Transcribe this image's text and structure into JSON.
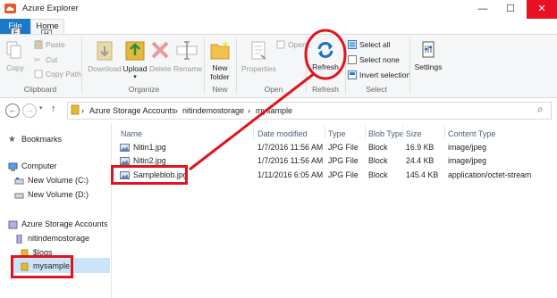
{
  "window": {
    "title": "Azure Explorer",
    "minimize": "—",
    "maximize": "☐",
    "close": "✕"
  },
  "ribbon_tabs": {
    "file": "File",
    "file_keytip": "F",
    "home": "Home",
    "home_keytip": "H"
  },
  "clipboard": {
    "copy": "Copy",
    "paste": "Paste",
    "cut": "Cut",
    "copy_path": "Copy Path",
    "label": "Clipboard"
  },
  "organize": {
    "download": "Download",
    "upload": "Upload",
    "delete": "Delete",
    "rename": "Rename",
    "label": "Organize"
  },
  "new_group": {
    "new_folder_line1": "New",
    "new_folder_line2": "folder",
    "label": "New"
  },
  "open_group": {
    "properties": "Properties",
    "open": "Open",
    "refresh": "Refresh",
    "label": "Open",
    "refresh_label": "Refresh"
  },
  "select_group": {
    "select_all": "Select all",
    "select_none": "Select none",
    "invert": "Invert selection",
    "label": "Select"
  },
  "settings": {
    "label": "Settings"
  },
  "address": {
    "root": "Azure Storage Accounts",
    "account": "nitindemostorage",
    "container": "mysample",
    "sep": "›",
    "back": "←",
    "forward": "→",
    "up": "↑",
    "search": "⌕"
  },
  "nav": {
    "bookmarks": "Bookmarks",
    "computer": "Computer",
    "drive_c": "New Volume (C:)",
    "drive_d": "New Volume (D:)",
    "azure": "Azure Storage Accounts",
    "account": "nitindemostorage",
    "logs": "$logs",
    "mysample": "mysample"
  },
  "columns": {
    "name": "Name",
    "date": "Date modified",
    "type": "Type",
    "blob_type": "Blob Type",
    "size": "Size",
    "content_type": "Content Type"
  },
  "files": [
    {
      "name": "Nitin1.jpg",
      "date": "1/7/2016 11:56 AM",
      "type": "JPG File",
      "blob_type": "Block",
      "size": "16.9 KB",
      "content_type": "image/jpeg"
    },
    {
      "name": "Nitin2.jpg",
      "date": "1/7/2016 11:56 AM",
      "type": "JPG File",
      "blob_type": "Block",
      "size": "24.4 KB",
      "content_type": "image/jpeg"
    },
    {
      "name": "Sampleblob.jpg",
      "date": "1/11/2016 6:05 AM",
      "type": "JPG File",
      "blob_type": "Block",
      "size": "145.4 KB",
      "content_type": "application/octet-stream"
    }
  ],
  "colors": {
    "accent": "#1979ca",
    "annotation": "#e0141e",
    "folder": "#e2b93b"
  }
}
